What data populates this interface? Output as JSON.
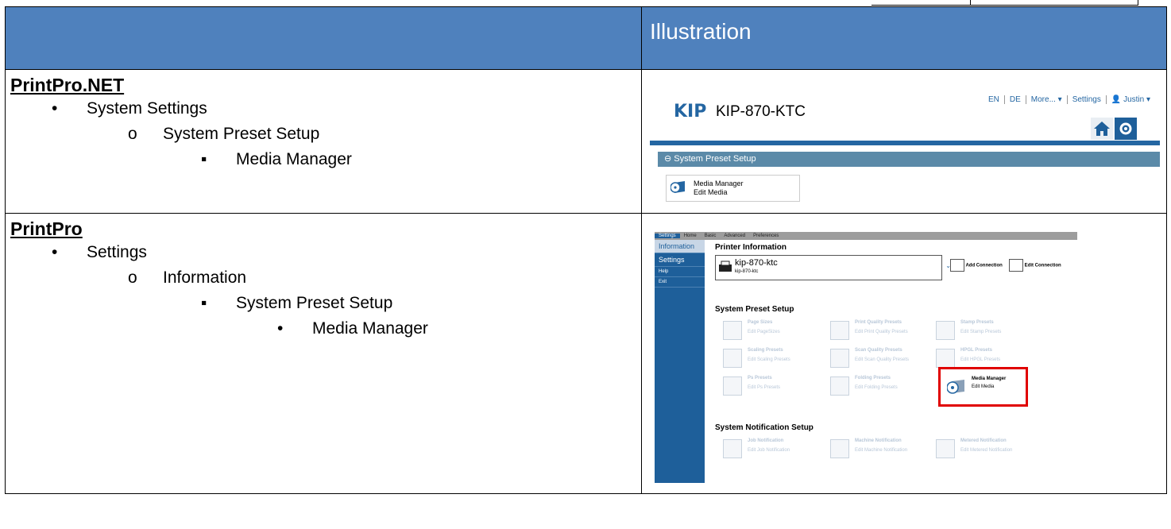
{
  "header": {
    "left_label": "",
    "right_label": "Illustration"
  },
  "rows": [
    {
      "title": "PrintPro.NET",
      "lines": [
        {
          "bullet": "•",
          "text": "System Settings"
        },
        {
          "bullet": "o",
          "text": "System Preset Setup"
        },
        {
          "bullet": "▪",
          "text": "Media Manager"
        }
      ]
    },
    {
      "title": "PrintPro",
      "lines": [
        {
          "bullet": "•",
          "text": "Settings"
        },
        {
          "bullet": "o",
          "text": "Information"
        },
        {
          "bullet": "▪",
          "text": "System Preset Setup"
        },
        {
          "bullet": "•",
          "text": "Media Manager"
        }
      ]
    }
  ],
  "kip_net": {
    "logo": "KIP",
    "printer_name": "KIP-870-KTC",
    "nav": [
      "EN",
      "DE",
      "More... ▾",
      "Settings",
      "👤 Justin ▾"
    ],
    "preset_bar": "⊖  System Preset Setup",
    "media_manager_title": "Media Manager",
    "media_manager_sub": "Edit Media"
  },
  "printpro": {
    "tabs": [
      "Settings",
      "Home",
      "Basic",
      "Advanced",
      "Preferences"
    ],
    "side": [
      "Information",
      "Settings",
      "Help",
      "Exit"
    ],
    "printer_info_title": "Printer Information",
    "combo_name": "kip-870-ktc",
    "combo_sub": "kip-870-ktc",
    "add_connection": "Add Connection",
    "edit_connection": "Edit Connection",
    "preset_title": "System Preset Setup",
    "presets": [
      {
        "t": "Page Sizes",
        "s": "Edit PageSizes"
      },
      {
        "t": "Print Quality Presets",
        "s": "Edit Print Quality Presets"
      },
      {
        "t": "Stamp Presets",
        "s": "Edit Stamp Presets"
      },
      {
        "t": "Scaling Presets",
        "s": "Edit Scaling Presets"
      },
      {
        "t": "Scan Quality Presets",
        "s": "Edit Scan Quality Presets"
      },
      {
        "t": "HPGL Presets",
        "s": "Edit HPGL Presets"
      },
      {
        "t": "Ps Presets",
        "s": "Edit Ps Presets"
      },
      {
        "t": "Folding Presets",
        "s": "Edit Folding Presets"
      }
    ],
    "media_manager_title": "Media Manager",
    "media_manager_sub": "Edit Media",
    "notif_title": "System Notification Setup",
    "notifs": [
      {
        "t": "Job Notification",
        "s": "Edit Job Notification"
      },
      {
        "t": "Machine Notification",
        "s": "Edit Machine Notification"
      },
      {
        "t": "Metered Notification",
        "s": "Edit Metered Notification"
      }
    ]
  }
}
